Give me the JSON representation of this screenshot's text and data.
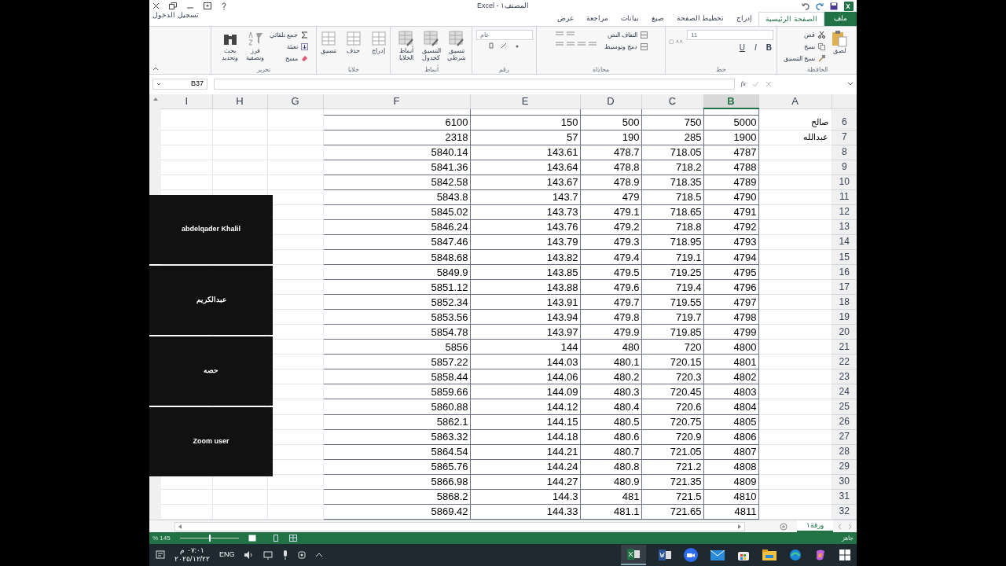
{
  "window": {
    "title": "المصنف١ - Excel",
    "sign_in": "تسجيل الدخول"
  },
  "tabs": [
    {
      "label": "ملف",
      "kind": "file",
      "selected": false
    },
    {
      "label": "الصفحة الرئيسية",
      "kind": "tab",
      "selected": true
    },
    {
      "label": "إدراج",
      "kind": "tab",
      "selected": false
    },
    {
      "label": "تخطيط الصفحة",
      "kind": "tab",
      "selected": false
    },
    {
      "label": "صيغ",
      "kind": "tab",
      "selected": false
    },
    {
      "label": "بيانات",
      "kind": "tab",
      "selected": false
    },
    {
      "label": "مراجعة",
      "kind": "tab",
      "selected": false
    },
    {
      "label": "عرض",
      "kind": "tab",
      "selected": false
    }
  ],
  "ribbon": {
    "groups": [
      {
        "label": "الحافظة",
        "items": [
          {
            "label": "قص",
            "kind": "small"
          },
          {
            "label": "نسخ",
            "kind": "small"
          },
          {
            "label": "نسخ التنسيق",
            "kind": "small"
          },
          {
            "label": "لصق",
            "kind": "large"
          }
        ]
      },
      {
        "label": "خط",
        "items": [
          {
            "label": "11",
            "kind": "field"
          },
          {
            "label": "U",
            "kind": "glyph"
          },
          {
            "label": "I",
            "kind": "glyph"
          },
          {
            "label": "B",
            "kind": "glyph"
          }
        ]
      },
      {
        "label": "محاذاة",
        "items": [
          {
            "label": "التفاف النص",
            "kind": "small"
          },
          {
            "label": "دمج وتوسيط",
            "kind": "small"
          }
        ]
      },
      {
        "label": "رقم",
        "items": [
          {
            "label": "عام",
            "kind": "field"
          }
        ]
      },
      {
        "label": "أنماط",
        "items": [
          {
            "label": "تنسيق شرطي",
            "kind": "large"
          },
          {
            "label": "التنسيق كجدول",
            "kind": "large"
          },
          {
            "label": "أنماط الخلايا",
            "kind": "large"
          }
        ]
      },
      {
        "label": "خلايا",
        "items": [
          {
            "label": "إدراج",
            "kind": "large"
          },
          {
            "label": "حذف",
            "kind": "large"
          },
          {
            "label": "تنسيق",
            "kind": "large"
          }
        ]
      },
      {
        "label": "تحرير",
        "items": [
          {
            "label": "جمع تلقائي",
            "kind": "small"
          },
          {
            "label": "تعبئة",
            "kind": "small"
          },
          {
            "label": "مسح",
            "kind": "small"
          },
          {
            "label": "فرز وتصفية",
            "kind": "large"
          },
          {
            "label": "بحث وتحديد",
            "kind": "large"
          }
        ]
      }
    ]
  },
  "formula_bar": {
    "name_box": "B37",
    "function_label": "fx"
  },
  "sheet": {
    "columns": [
      {
        "label": "I",
        "selected": false
      },
      {
        "label": "H",
        "selected": false
      },
      {
        "label": "G",
        "selected": false
      },
      {
        "label": "F",
        "selected": false
      },
      {
        "label": "E",
        "selected": false
      },
      {
        "label": "D",
        "selected": false
      },
      {
        "label": "C",
        "selected": false
      },
      {
        "label": "B",
        "selected": true
      },
      {
        "label": "A",
        "selected": false
      }
    ],
    "rows": [
      {
        "values": [
          "6100",
          "150",
          "500",
          "750",
          "5000"
        ],
        "name": "صالح",
        "number": "6"
      },
      {
        "values": [
          "2318",
          "57",
          "190",
          "285",
          "1900"
        ],
        "name": "عبدالله",
        "number": "7"
      },
      {
        "values": [
          "5840.14",
          "143.61",
          "478.7",
          "718.05",
          "4787"
        ],
        "number": "8"
      },
      {
        "values": [
          "5841.36",
          "143.64",
          "478.8",
          "718.2",
          "4788"
        ],
        "number": "9"
      },
      {
        "values": [
          "5842.58",
          "143.67",
          "478.9",
          "718.35",
          "4789"
        ],
        "number": "10"
      },
      {
        "values": [
          "5843.8",
          "143.7",
          "479",
          "718.5",
          "4790"
        ],
        "number": "11"
      },
      {
        "values": [
          "5845.02",
          "143.73",
          "479.1",
          "718.65",
          "4791"
        ],
        "number": "12"
      },
      {
        "values": [
          "5846.24",
          "143.76",
          "479.2",
          "718.8",
          "4792"
        ],
        "number": "13"
      },
      {
        "values": [
          "5847.46",
          "143.79",
          "479.3",
          "718.95",
          "4793"
        ],
        "number": "14"
      },
      {
        "values": [
          "5848.68",
          "143.82",
          "479.4",
          "719.1",
          "4794"
        ],
        "number": "15"
      },
      {
        "values": [
          "5849.9",
          "143.85",
          "479.5",
          "719.25",
          "4795"
        ],
        "number": "16"
      },
      {
        "values": [
          "5851.12",
          "143.88",
          "479.6",
          "719.4",
          "4796"
        ],
        "number": "17"
      },
      {
        "values": [
          "5852.34",
          "143.91",
          "479.7",
          "719.55",
          "4797"
        ],
        "number": "18"
      },
      {
        "values": [
          "5853.56",
          "143.94",
          "479.8",
          "719.7",
          "4798"
        ],
        "number": "19"
      },
      {
        "values": [
          "5854.78",
          "143.97",
          "479.9",
          "719.85",
          "4799"
        ],
        "number": "20"
      },
      {
        "values": [
          "5856",
          "144",
          "480",
          "720",
          "4800"
        ],
        "number": "21"
      },
      {
        "values": [
          "5857.22",
          "144.03",
          "480.1",
          "720.15",
          "4801"
        ],
        "number": "22"
      },
      {
        "values": [
          "5858.44",
          "144.06",
          "480.2",
          "720.3",
          "4802"
        ],
        "number": "23"
      },
      {
        "values": [
          "5859.66",
          "144.09",
          "480.3",
          "720.45",
          "4803"
        ],
        "number": "24"
      },
      {
        "values": [
          "5860.88",
          "144.12",
          "480.4",
          "720.6",
          "4804"
        ],
        "number": "25"
      },
      {
        "values": [
          "5862.1",
          "144.15",
          "480.5",
          "720.75",
          "4805"
        ],
        "number": "26"
      },
      {
        "values": [
          "5863.32",
          "144.18",
          "480.6",
          "720.9",
          "4806"
        ],
        "number": "27"
      },
      {
        "values": [
          "5864.54",
          "144.21",
          "480.7",
          "721.05",
          "4807"
        ],
        "number": "28"
      },
      {
        "values": [
          "5865.76",
          "144.24",
          "480.8",
          "721.2",
          "4808"
        ],
        "number": "29"
      },
      {
        "values": [
          "5866.98",
          "144.27",
          "480.9",
          "721.35",
          "4809"
        ],
        "number": "30"
      },
      {
        "values": [
          "5868.2",
          "144.3",
          "481",
          "721.5",
          "4810"
        ],
        "number": "31"
      },
      {
        "values": [
          "5869.42",
          "144.33",
          "481.1",
          "721.65",
          "4811"
        ],
        "number": "32"
      }
    ]
  },
  "participants": [
    {
      "name": "abdelqader Khalil"
    },
    {
      "name": "عبدالكريم"
    },
    {
      "name": "حصه"
    },
    {
      "name": "Zoom user"
    }
  ],
  "sheet_tabs": [
    {
      "label": "ورقة١",
      "selected": true
    }
  ],
  "status_bar": {
    "status": "جاهز",
    "zoom": "145 %",
    "zoom_slider": {
      "level": 0.5
    }
  },
  "taskbar": {
    "language": "ENG",
    "time": "٠٧:٠١ م",
    "date": "٢٠٢٥/١٢/٢٢"
  }
}
